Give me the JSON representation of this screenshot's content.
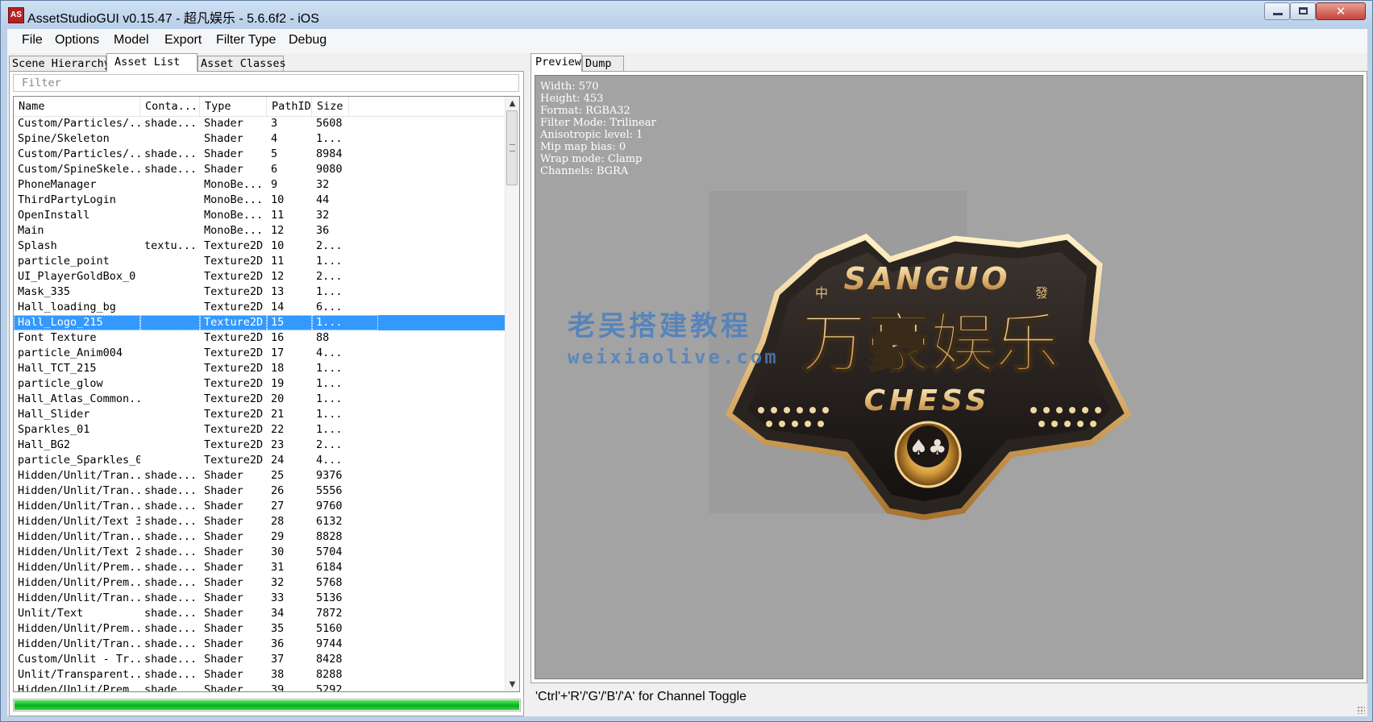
{
  "window": {
    "title": "AssetStudioGUI v0.15.47 - 超凡娱乐 - 5.6.6f2 - iOS",
    "app_icon_text": "AS",
    "close_glyph": "✕"
  },
  "menu": [
    "File",
    "Options",
    "Model",
    "Export",
    "Filter Type",
    "Debug"
  ],
  "left_tabs": [
    "Scene Hierarchy",
    "Asset List",
    "Asset Classes"
  ],
  "active_left_tab": "Asset List",
  "filter": {
    "placeholder": "Filter"
  },
  "asset_list": {
    "columns": [
      "Name",
      "Conta...",
      "Type",
      "PathID",
      "Size"
    ],
    "selected_index": 13,
    "rows": [
      [
        "Custom/Particles/...",
        "shade...",
        "Shader",
        "3",
        "5608"
      ],
      [
        "Spine/Skeleton",
        "",
        "Shader",
        "4",
        "1..."
      ],
      [
        "Custom/Particles/...",
        "shade...",
        "Shader",
        "5",
        "8984"
      ],
      [
        "Custom/SpineSkele...",
        "shade...",
        "Shader",
        "6",
        "9080"
      ],
      [
        "PhoneManager",
        "",
        "MonoBe...",
        "9",
        "32"
      ],
      [
        "ThirdPartyLogin",
        "",
        "MonoBe...",
        "10",
        "44"
      ],
      [
        "OpenInstall",
        "",
        "MonoBe...",
        "11",
        "32"
      ],
      [
        "Main",
        "",
        "MonoBe...",
        "12",
        "36"
      ],
      [
        "Splash",
        "textu...",
        "Texture2D",
        "10",
        "2..."
      ],
      [
        "particle_point",
        "",
        "Texture2D",
        "11",
        "1..."
      ],
      [
        "UI_PlayerGoldBox_0",
        "",
        "Texture2D",
        "12",
        "2..."
      ],
      [
        "Mask_335",
        "",
        "Texture2D",
        "13",
        "1..."
      ],
      [
        "Hall_loading_bg",
        "",
        "Texture2D",
        "14",
        "6..."
      ],
      [
        "Hall_Logo_215",
        "",
        "Texture2D",
        "15",
        "1..."
      ],
      [
        "Font Texture",
        "",
        "Texture2D",
        "16",
        "88"
      ],
      [
        "particle_Anim004",
        "",
        "Texture2D",
        "17",
        "4..."
      ],
      [
        "Hall_TCT_215",
        "",
        "Texture2D",
        "18",
        "1..."
      ],
      [
        "particle_glow",
        "",
        "Texture2D",
        "19",
        "1..."
      ],
      [
        "Hall_Atlas_Common...",
        "",
        "Texture2D",
        "20",
        "1..."
      ],
      [
        "Hall_Slider",
        "",
        "Texture2D",
        "21",
        "1..."
      ],
      [
        "Sparkles_01",
        "",
        "Texture2D",
        "22",
        "1..."
      ],
      [
        "Hall_BG2",
        "",
        "Texture2D",
        "23",
        "2..."
      ],
      [
        "particle_Sparkles_02",
        "",
        "Texture2D",
        "24",
        "4..."
      ],
      [
        "Hidden/Unlit/Tran...",
        "shade...",
        "Shader",
        "25",
        "9376"
      ],
      [
        "Hidden/Unlit/Tran...",
        "shade...",
        "Shader",
        "26",
        "5556"
      ],
      [
        "Hidden/Unlit/Tran...",
        "shade...",
        "Shader",
        "27",
        "9760"
      ],
      [
        "Hidden/Unlit/Text 3",
        "shade...",
        "Shader",
        "28",
        "6132"
      ],
      [
        "Hidden/Unlit/Tran...",
        "shade...",
        "Shader",
        "29",
        "8828"
      ],
      [
        "Hidden/Unlit/Text 2",
        "shade...",
        "Shader",
        "30",
        "5704"
      ],
      [
        "Hidden/Unlit/Prem...",
        "shade...",
        "Shader",
        "31",
        "6184"
      ],
      [
        "Hidden/Unlit/Prem...",
        "shade...",
        "Shader",
        "32",
        "5768"
      ],
      [
        "Hidden/Unlit/Tran...",
        "shade...",
        "Shader",
        "33",
        "5136"
      ],
      [
        "Unlit/Text",
        "shade...",
        "Shader",
        "34",
        "7872"
      ],
      [
        "Hidden/Unlit/Prem...",
        "shade...",
        "Shader",
        "35",
        "5160"
      ],
      [
        "Hidden/Unlit/Tran...",
        "shade...",
        "Shader",
        "36",
        "9744"
      ],
      [
        "Custom/Unlit - Tr...",
        "shade...",
        "Shader",
        "37",
        "8428"
      ],
      [
        "Unlit/Transparent...",
        "shade...",
        "Shader",
        "38",
        "8288"
      ],
      [
        "Hidden/Unlit/Prem...",
        "shade...",
        "Shader",
        "39",
        "5292"
      ]
    ]
  },
  "progress": {
    "value": 1.0
  },
  "right_tabs": [
    "Preview",
    "Dump"
  ],
  "active_right_tab": "Preview",
  "texture_info": [
    "Width: 570",
    "Height: 453",
    "Format: RGBA32",
    "Filter Mode: Trilinear",
    "Anisotropic level: 1",
    "Mip map bias: 0",
    "Wrap mode: Clamp",
    "Channels: BGRA"
  ],
  "logo": {
    "top_text": "SANGUO",
    "main_text": "万豪娱乐",
    "bottom_text": "CHESS",
    "left_mark": "中",
    "right_mark": "發"
  },
  "watermark": {
    "line1": "老吴搭建教程",
    "line2": "weixiaolive.com"
  },
  "status_text": "'Ctrl'+'R'/'G'/'B'/'A' for Channel Toggle",
  "colors": {
    "selection": "#3399ff",
    "preview_bg": "#a3a3a3",
    "progress": "#06b025",
    "logo_gold": "#e8c98a"
  }
}
